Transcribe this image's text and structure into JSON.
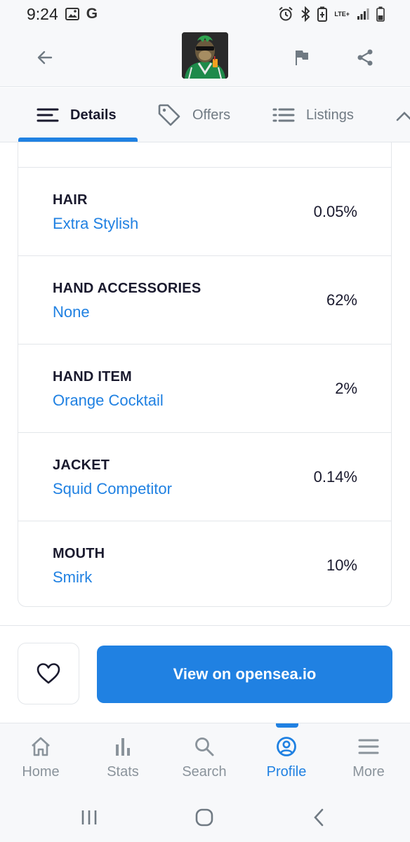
{
  "status_bar": {
    "time": "9:24",
    "left_icons": [
      "gallery-icon",
      "google-icon"
    ],
    "google_letter": "G",
    "right_icons": [
      "alarm-icon",
      "bluetooth-icon",
      "battery-saver-icon",
      "lte-icon",
      "signal-icon",
      "battery-icon"
    ],
    "network": "LTE+"
  },
  "app_bar": {
    "back_icon": "arrow-back-icon",
    "avatar_alt": "NFT avatar",
    "flag_icon": "flag-icon",
    "share_icon": "share-icon"
  },
  "tabs": [
    {
      "label": "Details",
      "icon": "details-lines-icon",
      "active": true
    },
    {
      "label": "Offers",
      "icon": "tag-icon",
      "active": false
    },
    {
      "label": "Listings",
      "icon": "list-icon",
      "active": false
    }
  ],
  "traits": [
    {
      "type": "HAIR",
      "value": "Extra Stylish",
      "rarity": "0.05%"
    },
    {
      "type": "HAND ACCESSORIES",
      "value": "None",
      "rarity": "62%"
    },
    {
      "type": "HAND ITEM",
      "value": "Orange Cocktail",
      "rarity": "2%"
    },
    {
      "type": "JACKET",
      "value": "Squid Competitor",
      "rarity": "0.14%"
    },
    {
      "type": "MOUTH",
      "value": "Smirk",
      "rarity": "10%"
    }
  ],
  "actions": {
    "favorite_icon": "heart-icon",
    "view_button": "View on opensea.io"
  },
  "bottom_nav": [
    {
      "label": "Home",
      "icon": "home-icon",
      "active": false
    },
    {
      "label": "Stats",
      "icon": "stats-icon",
      "active": false
    },
    {
      "label": "Search",
      "icon": "search-icon",
      "active": false
    },
    {
      "label": "Profile",
      "icon": "profile-icon",
      "active": true
    },
    {
      "label": "More",
      "icon": "menu-icon",
      "active": false
    }
  ],
  "colors": {
    "accent": "#2081e2",
    "text_primary": "#1a1a2e",
    "text_muted": "#707a83",
    "border": "#e3e6ea",
    "bar_background": "#f7f8fa"
  }
}
